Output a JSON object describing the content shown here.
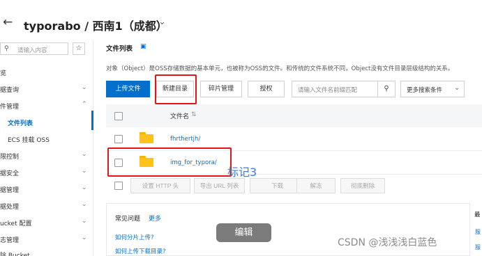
{
  "header": {
    "back_icon": "←",
    "title": "typorabo / 西南1（成都）",
    "chevron_icon": "⌄"
  },
  "sidebar": {
    "search_placeholder": "请输入内容",
    "search_icon": "⚲",
    "star_icon": "☆",
    "items": [
      {
        "label": "览",
        "chevron": ""
      },
      {
        "label": "据查询",
        "chevron": "⌄"
      },
      {
        "label": "件管理",
        "chevron": "⌃"
      },
      {
        "label": "文件列表",
        "chevron": "",
        "active": true
      },
      {
        "label": "ECS 挂载 OSS",
        "chevron": ""
      },
      {
        "label": "限控制",
        "chevron": "⌄"
      },
      {
        "label": "据安全",
        "chevron": "⌄"
      },
      {
        "label": "据管理",
        "chevron": "⌄"
      },
      {
        "label": "据处理",
        "chevron": "⌄"
      },
      {
        "label": "ucket 配置",
        "chevron": "⌄"
      },
      {
        "label": "志管理",
        "chevron": "⌄"
      },
      {
        "label": "除 Bucket",
        "chevron": ""
      }
    ]
  },
  "main": {
    "section_title": "文件列表",
    "section_icon": "▣",
    "description": "对象（Object）是OSS存储数据的基本单元，也被称为OSS的文件。和传统的文件系统不同，Object没有文件目录层级结构的关系。",
    "toolbar": {
      "upload": "上传文件",
      "new_dir": "新建目录",
      "fragments": "碎片管理",
      "authorize": "授权",
      "search_placeholder": "请输入文件名前缀匹配",
      "search_icon": "⚲",
      "more_filters": "更多搜索条件",
      "more_chevron": "⌄"
    },
    "table": {
      "col_name": "文件名",
      "sort_icon": "⇅",
      "rows": [
        {
          "name": "fhrthertjh/"
        },
        {
          "name": "img_for_typora/"
        }
      ]
    },
    "bulk": {
      "set_http": "设置 HTTP 头",
      "export_url": "导出 URL 列表",
      "download": "下载",
      "unfreeze": "解冻",
      "delete_all": "彻底删除"
    },
    "faq": {
      "title": "常见问题",
      "more": "更多",
      "questions": [
        "如何分片上传?",
        "如何上传下载目录?"
      ]
    },
    "right_col": {
      "title": "最",
      "link1": "服",
      "link2": "服"
    }
  },
  "overlays": {
    "annotation_label": "标记3",
    "edit_chip": "编辑",
    "watermark": "CSDN @浅浅浅白蓝色",
    "annotation_color": "#e01616",
    "accent": "#0070cc"
  }
}
